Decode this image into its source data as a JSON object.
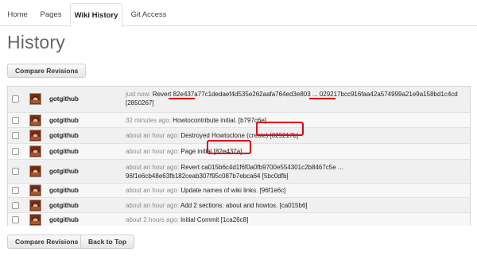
{
  "tabs": [
    {
      "label": "Home"
    },
    {
      "label": "Pages"
    },
    {
      "label": "Wiki History",
      "active": true
    },
    {
      "label": "Git Access"
    }
  ],
  "page_title": "History",
  "buttons": {
    "compare_top": "Compare Revisions",
    "compare_bottom": "Compare Revisions",
    "back_to_top": "Back to Top"
  },
  "revisions": [
    {
      "user": "gotgithub",
      "time": "just now:",
      "msg_a": "Revert ",
      "hash1": "82e437a77c1dedaef4d535e262aafa764ed3e803",
      "ellipsis": " ... ",
      "hash2": "029217bcc916faa42a574999a21e9a158bd1c4cd",
      "line2": "[2850267]"
    },
    {
      "user": "gotgithub",
      "time": "32 minutes ago:",
      "message": "Howtocontribute initial. [b797c6e]"
    },
    {
      "user": "gotgithub",
      "time": "about an hour ago:",
      "message": "Destroyed Howtoclone (creole)",
      "sha": "[029217b]"
    },
    {
      "user": "gotgithub",
      "time": "about an hour ago:",
      "message": "Page initial",
      "sha": "[82e437a]"
    },
    {
      "user": "gotgithub",
      "time": "about an hour ago:",
      "message": "Revert ca015b6c4d1f6f0a0fb9700e554301c2b8467c5e ...",
      "line2": "96f1e6cb48e63fb182ceab307f95c087b7ebca64 [5bc0dfb]"
    },
    {
      "user": "gotgithub",
      "time": "about an hour ago:",
      "message": "Update names of wiki links. [96f1e6c]"
    },
    {
      "user": "gotgithub",
      "time": "about an hour ago:",
      "message": "Add 2 sections: about and howtos. [ca015b6]"
    },
    {
      "user": "gotgithub",
      "time": "about 2 hours ago:",
      "message": "Initial Commit [1ca26c8]"
    }
  ],
  "annotation_color": "#e0001b"
}
